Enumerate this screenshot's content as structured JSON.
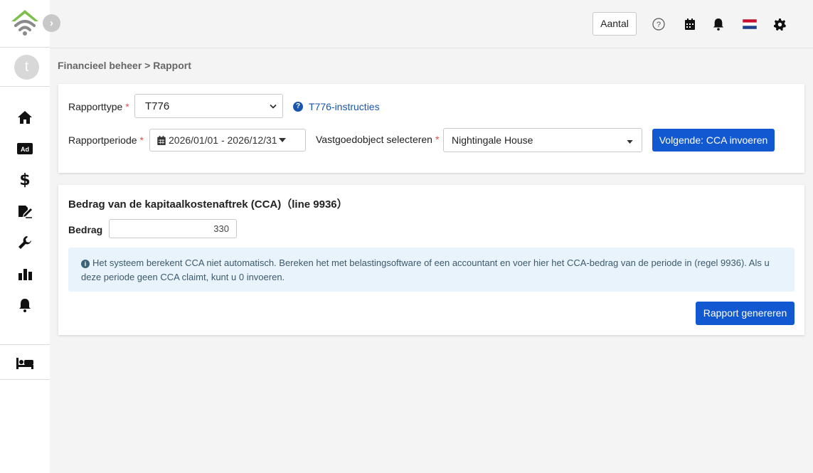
{
  "sidebar": {
    "avatar_initial": "t",
    "collapse_glyph": "›",
    "items": [
      {
        "icon": "home-icon"
      },
      {
        "icon": "ad-icon",
        "label": "Ad"
      },
      {
        "icon": "dollar-icon",
        "label": "$"
      },
      {
        "icon": "signature-icon"
      },
      {
        "icon": "wrench-icon"
      },
      {
        "icon": "bar-chart-icon"
      },
      {
        "icon": "bell-icon"
      },
      {
        "icon": "bed-icon"
      }
    ]
  },
  "topbar": {
    "aantal_label": "Aantal",
    "icons": [
      "help-icon",
      "calendar-icon",
      "bell-icon",
      "flag-nl-icon",
      "gear-icon"
    ]
  },
  "breadcrumb": "Financieel beheer > Rapport",
  "report_form": {
    "report_type_label": "Rapporttype",
    "report_type_value": "T776",
    "instructions_link": "T776-instructies",
    "period_label": "Rapportperiode",
    "period_value": "2026/01/01 - 2026/12/31",
    "property_label": "Vastgoedobject selecteren",
    "property_value": "Nightingale House",
    "next_button": "Volgende: CCA invoeren",
    "required_marker": "*"
  },
  "cca_section": {
    "title": "Bedrag van de kapitaalkostenaftrek (CCA)（line 9936）",
    "amount_label": "Bedrag",
    "amount_value": "330",
    "info_text": "Het systeem berekent CCA niet automatisch. Bereken het met belastingsoftware of een accountant en voer hier het CCA-bedrag van de periode in (regel 9936). Als u deze periode geen CCA claimt, kunt u 0 invoeren.",
    "generate_button": "Rapport genereren"
  },
  "colors": {
    "primary": "#1259d1",
    "link": "#1a56b0",
    "required": "#d9534f",
    "logo_green": "#7cc04b",
    "info_bg": "#e9f3fc"
  }
}
